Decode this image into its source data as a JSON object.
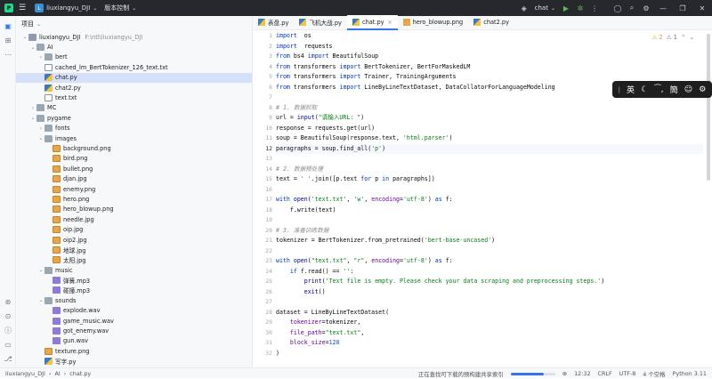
{
  "titlebar": {
    "project_badge": "L",
    "project_name": "liuxiangyu_DJI",
    "vcs_label": "版本控制",
    "run_config": "chat"
  },
  "project_panel": {
    "header": "项目",
    "tree": [
      {
        "label": "liuxiangyu_DJI",
        "hint": "F:\\ntl\\liuxiangyu_DJI",
        "depth": 0,
        "arrow": "⌄",
        "icon": "proj"
      },
      {
        "label": "AI",
        "depth": 1,
        "arrow": "⌄",
        "icon": "folder"
      },
      {
        "label": "bert",
        "depth": 2,
        "arrow": "›",
        "icon": "folder"
      },
      {
        "label": "cached_lm_BertTokenizer_126_text.txt",
        "depth": 2,
        "arrow": "",
        "icon": "txt"
      },
      {
        "label": "chat.py",
        "depth": 2,
        "arrow": "",
        "icon": "py",
        "selected": true
      },
      {
        "label": "chat2.py",
        "depth": 2,
        "arrow": "",
        "icon": "py"
      },
      {
        "label": "text.txt",
        "depth": 2,
        "arrow": "",
        "icon": "txt"
      },
      {
        "label": "MC",
        "depth": 1,
        "arrow": "›",
        "icon": "folder"
      },
      {
        "label": "pygame",
        "depth": 1,
        "arrow": "⌄",
        "icon": "folder"
      },
      {
        "label": "fonts",
        "depth": 2,
        "arrow": "›",
        "icon": "folder"
      },
      {
        "label": "images",
        "depth": 2,
        "arrow": "⌄",
        "icon": "folder"
      },
      {
        "label": "background.png",
        "depth": 3,
        "arrow": "",
        "icon": "img"
      },
      {
        "label": "bird.png",
        "depth": 3,
        "arrow": "",
        "icon": "img"
      },
      {
        "label": "bullet.png",
        "depth": 3,
        "arrow": "",
        "icon": "img"
      },
      {
        "label": "djan.jpg",
        "depth": 3,
        "arrow": "",
        "icon": "img"
      },
      {
        "label": "enemy.png",
        "depth": 3,
        "arrow": "",
        "icon": "img"
      },
      {
        "label": "hero.png",
        "depth": 3,
        "arrow": "",
        "icon": "img"
      },
      {
        "label": "hero_blowup.png",
        "depth": 3,
        "arrow": "",
        "icon": "img"
      },
      {
        "label": "needle.jpg",
        "depth": 3,
        "arrow": "",
        "icon": "img"
      },
      {
        "label": "oip.jpg",
        "depth": 3,
        "arrow": "",
        "icon": "img"
      },
      {
        "label": "oip2.jpg",
        "depth": 3,
        "arrow": "",
        "icon": "img"
      },
      {
        "label": "地球.jpg",
        "depth": 3,
        "arrow": "",
        "icon": "img"
      },
      {
        "label": "太阳.jpg",
        "depth": 3,
        "arrow": "",
        "icon": "img"
      },
      {
        "label": "music",
        "depth": 2,
        "arrow": "⌄",
        "icon": "folder"
      },
      {
        "label": "弹簧.mp3",
        "depth": 3,
        "arrow": "",
        "icon": "mp3"
      },
      {
        "label": "碰撞.mp3",
        "depth": 3,
        "arrow": "",
        "icon": "mp3"
      },
      {
        "label": "sounds",
        "depth": 2,
        "arrow": "⌄",
        "icon": "folder"
      },
      {
        "label": "explode.wav",
        "depth": 3,
        "arrow": "",
        "icon": "wav"
      },
      {
        "label": "game_music.wav",
        "depth": 3,
        "arrow": "",
        "icon": "wav"
      },
      {
        "label": "got_enemy.wav",
        "depth": 3,
        "arrow": "",
        "icon": "wav"
      },
      {
        "label": "gun.wav",
        "depth": 3,
        "arrow": "",
        "icon": "wav"
      },
      {
        "label": "texture.png",
        "depth": 2,
        "arrow": "",
        "icon": "img"
      },
      {
        "label": "写字.py",
        "depth": 2,
        "arrow": "",
        "icon": "py"
      }
    ]
  },
  "tabs": [
    {
      "label": "表盘.py",
      "icon": "py"
    },
    {
      "label": "飞机大战.py",
      "icon": "py"
    },
    {
      "label": "chat.py",
      "icon": "py",
      "active": true,
      "close": "×"
    },
    {
      "label": "hero_blowup.png",
      "icon": "img"
    },
    {
      "label": "chat2.py",
      "icon": "py"
    }
  ],
  "inspection": {
    "warnings": "⚠ 2",
    "weak": "⚠ 1"
  },
  "code_lines": [
    [
      [
        "k",
        "import"
      ],
      [
        "",
        "  os"
      ]
    ],
    [
      [
        "k",
        "import"
      ],
      [
        "",
        "  requests"
      ]
    ],
    [
      [
        "k",
        "from"
      ],
      [
        "",
        " bs4 "
      ],
      [
        "k",
        "import"
      ],
      [
        "",
        " BeautifulSoup"
      ]
    ],
    [
      [
        "k",
        "from"
      ],
      [
        "",
        " transformers "
      ],
      [
        "k",
        "import"
      ],
      [
        "",
        " BertTokenizer, BertForMaskedLM"
      ]
    ],
    [
      [
        "k",
        "from"
      ],
      [
        "",
        " transformers "
      ],
      [
        "k",
        "import"
      ],
      [
        "",
        " Trainer, TrainingArguments"
      ]
    ],
    [
      [
        "k",
        "from"
      ],
      [
        "",
        " transformers "
      ],
      [
        "k",
        "import"
      ],
      [
        "",
        " LineByLineTextDataset, DataCollatorForLanguageModeling"
      ]
    ],
    [],
    [
      [
        "c",
        "# 1. 数据抓取"
      ]
    ],
    [
      [
        "",
        "url = "
      ],
      [
        "bi",
        "input"
      ],
      [
        "",
        "("
      ],
      [
        "s",
        "\"请输入URL: \""
      ],
      [
        "",
        ")"
      ]
    ],
    [
      [
        "",
        "response = requests.get(url)"
      ]
    ],
    [
      [
        "",
        "soup = BeautifulSoup(response.text, "
      ],
      [
        "s",
        "'html.parser'"
      ],
      [
        "",
        ")"
      ]
    ],
    [
      [
        "",
        "paragraphs = soup.find_all("
      ],
      [
        "s",
        "'p'"
      ],
      [
        "",
        ")"
      ]
    ],
    [],
    [
      [
        "c",
        "# 2. 数据预处理"
      ]
    ],
    [
      [
        "",
        "text = "
      ],
      [
        "s",
        "' '"
      ],
      [
        "",
        ".join([p.text "
      ],
      [
        "k",
        "for"
      ],
      [
        "",
        " p "
      ],
      [
        "k",
        "in"
      ],
      [
        "",
        " paragraphs])"
      ]
    ],
    [],
    [
      [
        "k",
        "with"
      ],
      [
        "",
        ""
      ],
      [
        "bi",
        " open"
      ],
      [
        "",
        "("
      ],
      [
        "s",
        "'text.txt'"
      ],
      [
        "",
        ", "
      ],
      [
        "s",
        "'w'"
      ],
      [
        "",
        ", "
      ],
      [
        "p",
        "encoding"
      ],
      [
        "",
        "="
      ],
      [
        "s",
        "'utf-8'"
      ],
      [
        "",
        ") "
      ],
      [
        "k",
        "as"
      ],
      [
        "",
        " f:"
      ]
    ],
    [
      [
        "",
        "    f.write(text)"
      ]
    ],
    [],
    [
      [
        "c",
        "# 3. 准备训练数据"
      ]
    ],
    [
      [
        "",
        "tokenizer = BertTokenizer.from_pretrained("
      ],
      [
        "s",
        "'bert-base-uncased'"
      ],
      [
        "",
        ")"
      ]
    ],
    [],
    [
      [
        "k",
        "with"
      ],
      [
        "bi",
        " open"
      ],
      [
        "",
        "("
      ],
      [
        "s",
        "\"text.txt\""
      ],
      [
        "",
        ", "
      ],
      [
        "s",
        "\"r\""
      ],
      [
        "",
        ", "
      ],
      [
        "p",
        "encoding"
      ],
      [
        "",
        "="
      ],
      [
        "s",
        "'utf-8'"
      ],
      [
        "",
        ") "
      ],
      [
        "k",
        "as"
      ],
      [
        "",
        " f:"
      ]
    ],
    [
      [
        "",
        "    "
      ],
      [
        "k",
        "if"
      ],
      [
        "",
        " f.read() == "
      ],
      [
        "s",
        "''"
      ],
      [
        "",
        ":"
      ]
    ],
    [
      [
        "",
        "        "
      ],
      [
        "bi",
        "print"
      ],
      [
        "",
        "("
      ],
      [
        "s",
        "'Text file is empty. Please check your data scraping and preprocessing steps.'"
      ],
      [
        "",
        ")"
      ]
    ],
    [
      [
        "",
        "        "
      ],
      [
        "bi",
        "exit"
      ],
      [
        "",
        "()"
      ]
    ],
    [],
    [
      [
        "",
        "dataset = LineByLineTextDataset("
      ]
    ],
    [
      [
        "",
        "    "
      ],
      [
        "p",
        "tokenizer"
      ],
      [
        "",
        "=tokenizer,"
      ]
    ],
    [
      [
        "",
        "    "
      ],
      [
        "p",
        "file_path"
      ],
      [
        "",
        "="
      ],
      [
        "s",
        "\"text.txt\""
      ],
      [
        "",
        ","
      ]
    ],
    [
      [
        "",
        "    "
      ],
      [
        "p",
        "block_size"
      ],
      [
        "",
        "="
      ],
      [
        "n",
        "128"
      ]
    ],
    [
      [
        "",
        ")"
      ]
    ]
  ],
  "current_line": 12,
  "ime": {
    "mode": "英",
    "icons": [
      "moon-icon",
      "punct-icon",
      "simplified-label",
      "emoji-icon",
      "settings-icon"
    ],
    "simplified": "簡"
  },
  "statusbar": {
    "crumbs": [
      "liuxiangyu_DJI",
      "AI",
      "chat.py"
    ],
    "indexing": "正在查找可下载的预构建共享索引",
    "indexing_progress": 0.75,
    "position": "12:32",
    "line_sep": "CRLF",
    "encoding": "UTF-8",
    "indent": "4 个空格",
    "interpreter": "Python 3.11"
  },
  "colors": {
    "accent": "#3574f0",
    "selection": "#d5e1fb"
  }
}
